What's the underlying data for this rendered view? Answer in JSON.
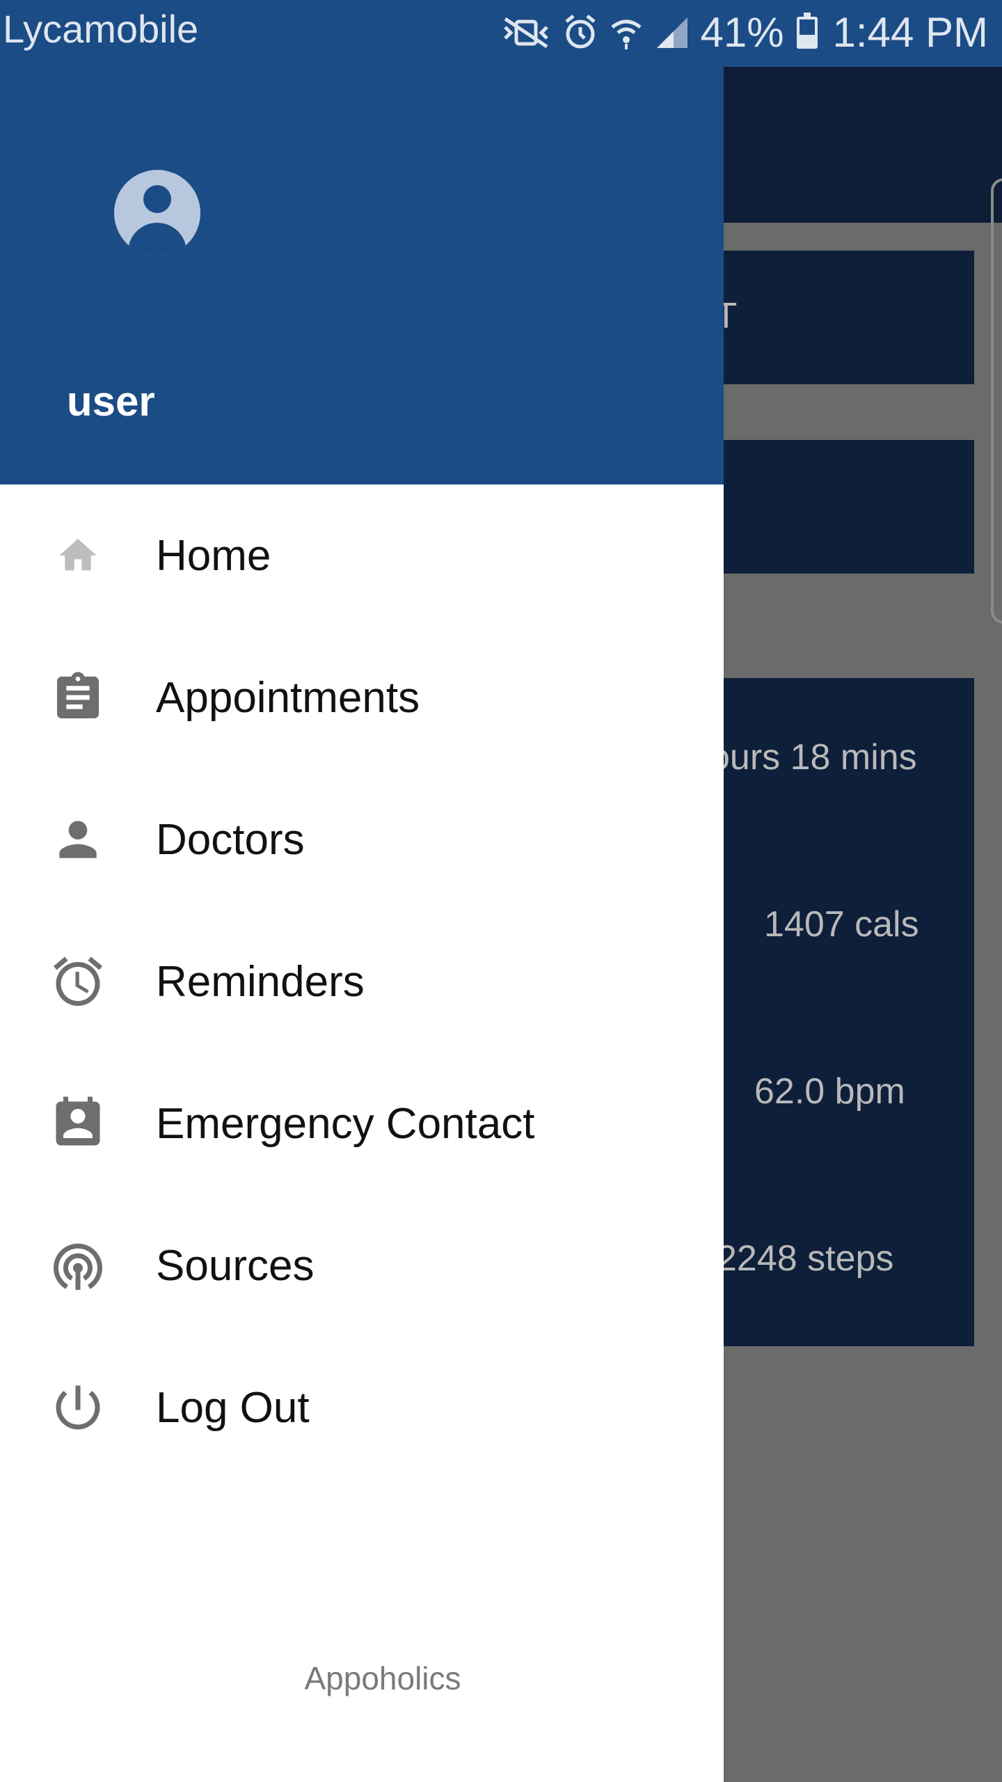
{
  "status_bar": {
    "carrier": "Lycamobile",
    "battery": "41%",
    "time": "1:44 PM",
    "icons": [
      "mute-vibrate-icon",
      "alarm-icon",
      "wifi-icon",
      "signal-icon",
      "battery-icon"
    ]
  },
  "drawer": {
    "user": {
      "name": "user",
      "avatar_icon": "account-circle-icon"
    },
    "items": [
      {
        "label": "Home",
        "icon": "home-icon"
      },
      {
        "label": "Appointments",
        "icon": "clipboard-icon"
      },
      {
        "label": "Doctors",
        "icon": "person-icon"
      },
      {
        "label": "Reminders",
        "icon": "alarm-clock-icon"
      },
      {
        "label": "Emergency Contact",
        "icon": "contact-card-icon"
      },
      {
        "label": "Sources",
        "icon": "broadcast-icon"
      },
      {
        "label": "Log Out",
        "icon": "power-icon"
      }
    ],
    "footer": "Appoholics"
  },
  "background_app": {
    "cards": [
      {
        "text": "CT"
      },
      {
        "text": ""
      },
      {
        "text": "ours 18 mins"
      },
      {
        "text": "1407 cals"
      },
      {
        "text": "62.0 bpm"
      },
      {
        "text": "2248 steps"
      }
    ]
  },
  "colors": {
    "header": "#1b4c86",
    "drawer_bg": "#ffffff",
    "icon_gray": "#8a8a8a",
    "app_navy": "#0e1f3a"
  }
}
